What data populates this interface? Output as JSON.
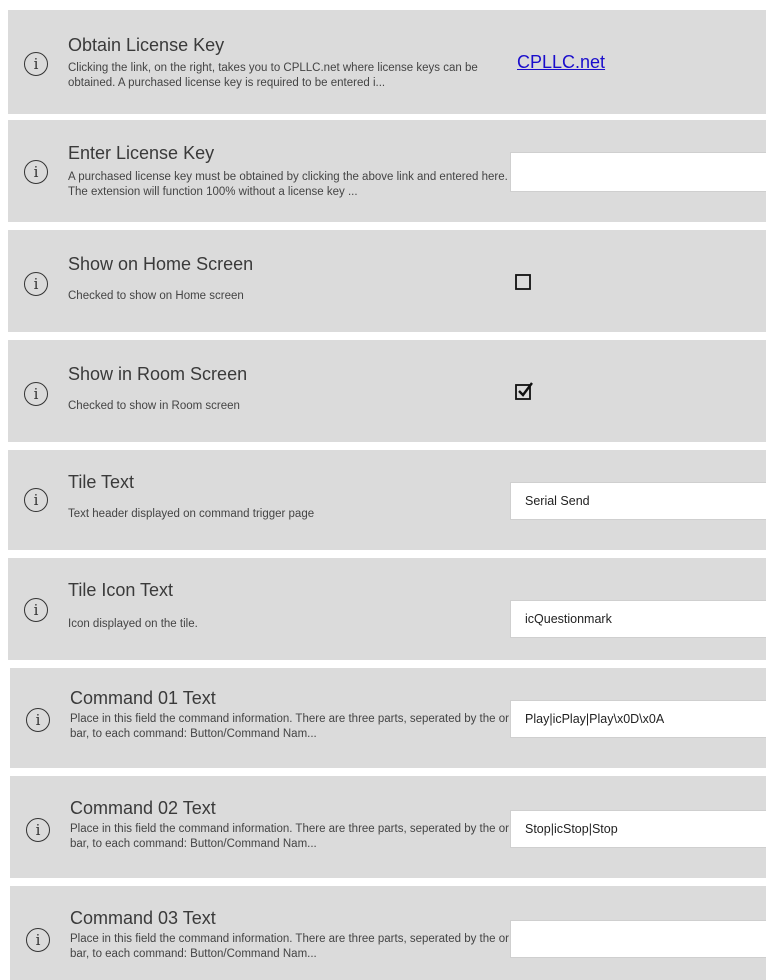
{
  "settings": [
    {
      "title": "Obtain License Key",
      "description": "Clicking the link, on the right, takes you to CPLLC.net where license keys can be obtained.  A purchased license key is required to be entered i...",
      "link_text": "CPLLC.net"
    },
    {
      "title": "Enter License Key",
      "description": "A purchased license key must be obtained by clicking the above link and entered here. The extension will function 100% without a license key ...",
      "value": ""
    },
    {
      "title": "Show on Home Screen",
      "description": "Checked to show on Home screen",
      "checked": false
    },
    {
      "title": "Show in Room Screen",
      "description": "Checked to show in Room screen",
      "checked": true
    },
    {
      "title": "Tile Text",
      "description": "Text header displayed on command trigger page",
      "value": "Serial Send"
    },
    {
      "title": "Tile Icon Text",
      "description": "Icon displayed on the tile.",
      "value": "icQuestionmark"
    },
    {
      "title": "Command 01 Text",
      "description": "Place in this field the command information.  There are three parts, seperated by the or bar, to each command: Button/Command Nam...",
      "value": "Play|icPlay|Play\\x0D\\x0A"
    },
    {
      "title": "Command 02 Text",
      "description": "Place in this field the command information.  There are three parts, seperated by the or bar, to each command: Button/Command Nam...",
      "value": "Stop|icStop|Stop"
    },
    {
      "title": "Command 03 Text",
      "description": "Place in this field the command information.  There are three parts, seperated by the or bar, to each command: Button/Command Nam...",
      "value": ""
    }
  ],
  "icons": {
    "info": "info-circle-icon",
    "checkbox": "checkbox-icon"
  },
  "colors": {
    "row_background": "#dbdbdb",
    "link": "#1a0dcc",
    "field_background": "#ffffff"
  }
}
